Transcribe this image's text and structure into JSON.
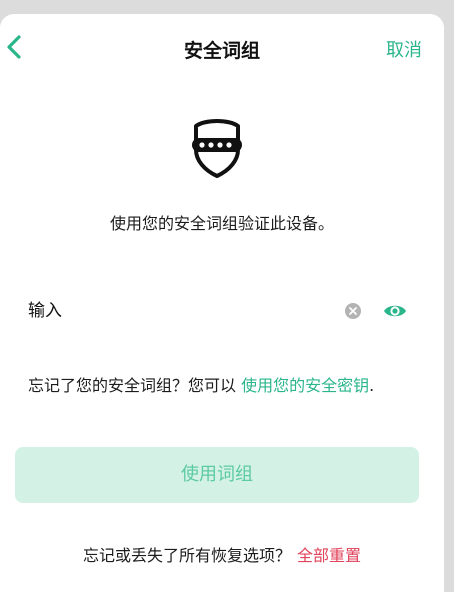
{
  "header": {
    "title": "安全词组",
    "cancel_label": "取消"
  },
  "main": {
    "description": "使用您的安全词组验证此设备。",
    "input": {
      "placeholder": "输入",
      "value": ""
    },
    "forgot": {
      "prefix": "忘记了您的安全词组？您可以 ",
      "link": "使用您的安全密钥",
      "suffix": "."
    },
    "primary_button": "使用词组",
    "reset": {
      "prefix": "忘记或丢失了所有恢复选项？",
      "link": "全部重置"
    }
  },
  "icons": {
    "back": "chevron-left-icon",
    "shield": "shield-keypad-icon",
    "clear": "clear-circle-icon",
    "eye": "eye-icon"
  },
  "colors": {
    "accent": "#2bb58b",
    "primary_button_bg": "#d3f2e5",
    "primary_button_text": "#5ccaa2",
    "danger": "#e0435a"
  }
}
